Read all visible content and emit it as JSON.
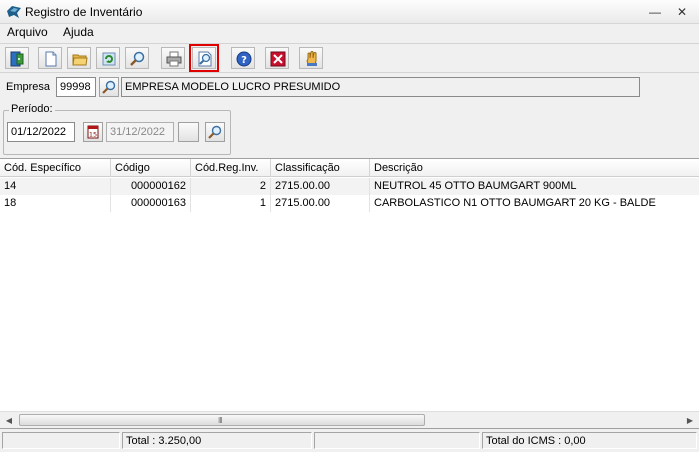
{
  "window": {
    "title": "Registro de Inventário",
    "minimize": "—",
    "close": "✕"
  },
  "menu": {
    "items": [
      "Arquivo",
      "Ajuda"
    ]
  },
  "toolbar": {
    "buttons": [
      "exit",
      "new",
      "open",
      "refresh",
      "search",
      "print",
      "preview",
      "help",
      "delete",
      "hand"
    ],
    "highlighted": "preview"
  },
  "empresa": {
    "label": "Empresa",
    "code": "99998",
    "name": "EMPRESA MODELO LUCRO PRESUMIDO"
  },
  "periodo": {
    "label": "Período:",
    "start": "01/12/2022",
    "end": "31/12/2022",
    "calendar_label": "15"
  },
  "grid": {
    "columns": [
      "Cód. Específico",
      "Código",
      "Cód.Reg.Inv.",
      "Classificação",
      "Descrição"
    ],
    "rows": [
      [
        "14",
        "000000162",
        "2",
        "2715.00.00",
        "NEUTROL 45 OTTO BAUMGART 900ML"
      ],
      [
        "18",
        "000000163",
        "1",
        "2715.00.00",
        "CARBOLASTICO N1 OTTO BAUMGART 20 KG - BALDE"
      ]
    ],
    "scroll_grip": "III"
  },
  "status": {
    "total": "Total : 3.250,00",
    "total_icms": "Total do ICMS : 0,00"
  },
  "colors": {
    "highlight": "#e00000",
    "window_bg": "#f0f0f0"
  }
}
